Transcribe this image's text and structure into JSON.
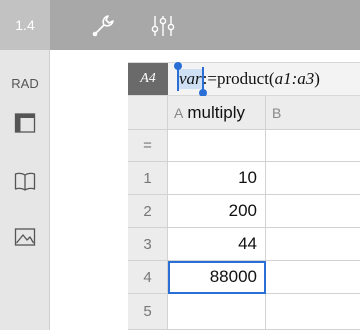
{
  "toolbar": {
    "page_tab": "1.4",
    "icons": [
      "wrench-icon",
      "sliders-icon"
    ]
  },
  "sidebar": {
    "angle_mode": "RAD",
    "icons": [
      "layout-icon",
      "book-icon",
      "image-icon"
    ]
  },
  "formula_bar": {
    "cell_ref": "A4",
    "var_name": "var",
    "expr_prefix": ":=product(",
    "expr_arg": "a1:a3",
    "expr_suffix": ")"
  },
  "grid": {
    "columns": [
      "A",
      "B"
    ],
    "column_a_name": "multiply",
    "formula_row_symbol": "=",
    "rows": [
      {
        "index": "1",
        "a": "10"
      },
      {
        "index": "2",
        "a": "200"
      },
      {
        "index": "3",
        "a": "44"
      },
      {
        "index": "4",
        "a": "88000"
      },
      {
        "index": "5",
        "a": ""
      }
    ],
    "selected_row": 4
  },
  "colors": {
    "toolbar": "#a8a8a8",
    "selection": "#2a6fd6",
    "header_bg": "#ececec"
  }
}
